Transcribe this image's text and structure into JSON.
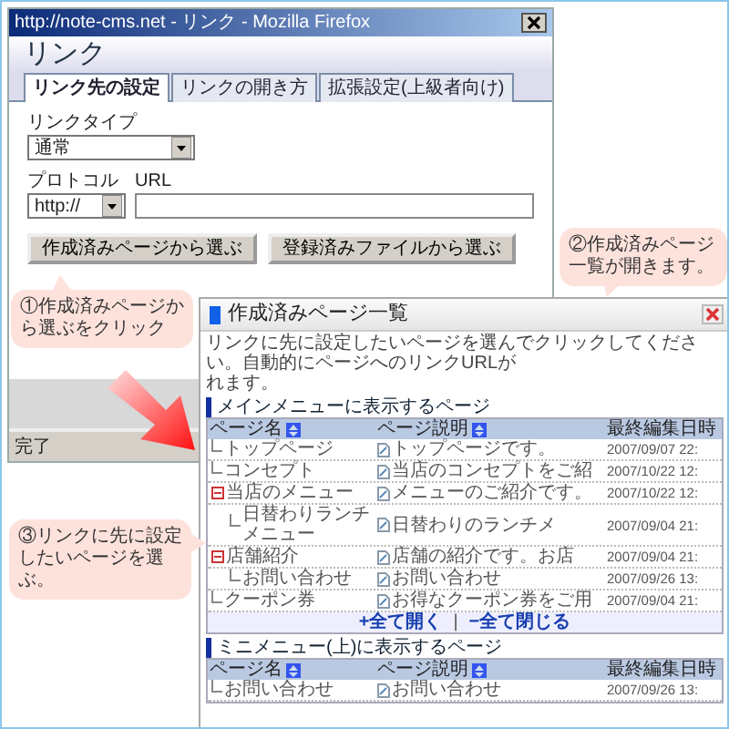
{
  "browser_window": {
    "title": "http://note-cms.net - リンク - Mozilla Firefox",
    "heading": "リンク",
    "tabs": [
      {
        "label": "リンク先の設定",
        "selected": true
      },
      {
        "label": "リンクの開き方",
        "selected": false
      },
      {
        "label": "拡張設定(上級者向け)",
        "selected": false
      }
    ],
    "link_type": {
      "label": "リンクタイプ",
      "value": "通常"
    },
    "protocol": {
      "label": "プロトコル",
      "value": "http://"
    },
    "url": {
      "label": "URL"
    },
    "buttons": [
      "作成済みページから選ぶ",
      "登録済みファイルから選ぶ"
    ],
    "status_bar": "完了"
  },
  "page_list_window": {
    "title": "作成済みページ一覧",
    "description": [
      "リンクに先に設定したいページを選んでクリックしてください。自動的にページへのリンクURLが",
      "れます。"
    ],
    "sections": [
      {
        "heading": "メインメニューに表示するページ",
        "columns": [
          {
            "label": "ページ名",
            "sortable": true
          },
          {
            "label": "ページ説明",
            "sortable": true
          },
          {
            "label": "最終編集日時",
            "sortable": false
          }
        ],
        "rows": [
          {
            "name": "トップページ",
            "description": "トップページです。",
            "edited": "2007/09/07 22:"
          },
          {
            "name": "コンセプト",
            "description": "当店のコンセプトをご紹",
            "edited": "2007/10/22 12:"
          },
          {
            "name": "当店のメニュー",
            "description": "メニューのご紹介です。",
            "edited": "2007/10/22 12:",
            "expanded": true,
            "children": [
              {
                "name": "日替わりランチメニュー",
                "description": "日替わりのランチメ",
                "edited": "2007/09/04 21:"
              }
            ]
          },
          {
            "name": "店舗紹介",
            "description": "店舗の紹介です。お店",
            "edited": "2007/09/04 21:",
            "expanded": true,
            "children": [
              {
                "name": "お問い合わせ",
                "description": "お問い合わせ",
                "edited": "2007/09/26 13:"
              }
            ]
          },
          {
            "name": "クーポン券",
            "description": "お得なクーポン券をご用",
            "edited": "2007/09/04 21:"
          }
        ],
        "footer": {
          "expand_all": "+全て開く",
          "separator": "|",
          "collapse_all": "−全て閉じる"
        }
      },
      {
        "heading": "ミニメニュー(上)に表示するページ",
        "columns": [
          {
            "label": "ページ名",
            "sortable": true
          },
          {
            "label": "ページ説明",
            "sortable": true
          },
          {
            "label": "最終編集日時",
            "sortable": false
          }
        ],
        "rows": [
          {
            "name": "お問い合わせ",
            "description": "お問い合わせ",
            "edited": "2007/09/26 13:"
          }
        ]
      }
    ]
  },
  "callouts": [
    {
      "text": "①作成済みページから選ぶをクリック"
    },
    {
      "text": "②作成済みページ一覧が開きます。"
    },
    {
      "text": "③リンクに先に設定したいページを選ぶ。"
    }
  ]
}
